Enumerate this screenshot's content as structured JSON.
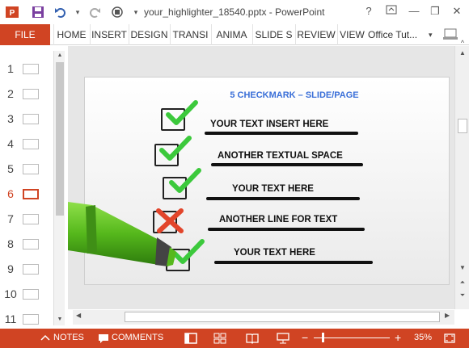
{
  "window": {
    "title": "your_highlighter_18540.pptx - PowerPoint",
    "help": "?",
    "minimize": "—",
    "restore": "❐",
    "close": "✕"
  },
  "ribbon": {
    "file": "FILE",
    "tabs": [
      "HOME",
      "INSERT",
      "DESIGN",
      "TRANSI",
      "ANIMA",
      "SLIDE S",
      "REVIEW",
      "VIEW"
    ],
    "account": "Office Tut..."
  },
  "thumbnails": {
    "numbers": [
      "1",
      "2",
      "3",
      "4",
      "5",
      "6",
      "7",
      "8",
      "9",
      "10",
      "11"
    ],
    "active": "6"
  },
  "slide": {
    "title": "5 CHECKMARK – SLIDE/PAGE",
    "items": [
      {
        "text": "YOUR TEXT INSERT HERE",
        "mark": "check"
      },
      {
        "text": "ANOTHER TEXTUAL SPACE",
        "mark": "check"
      },
      {
        "text": "YOUR TEXT HERE",
        "mark": "check"
      },
      {
        "text": "ANOTHER LINE FOR TEXT",
        "mark": "cross"
      },
      {
        "text": "YOUR TEXT HERE",
        "mark": "check"
      }
    ],
    "colors": {
      "check": "#3cc93c",
      "cross": "#e2452b",
      "highlighter": "#5cc21f",
      "title": "#3a6fd8"
    }
  },
  "statusbar": {
    "notes": "NOTES",
    "comments": "COMMENTS",
    "zoom_minus": "−",
    "zoom_plus": "+",
    "zoom": "35%"
  },
  "icons": {
    "app": "powerpoint-icon",
    "save": "save-icon",
    "undo": "undo-icon",
    "redo": "redo-icon",
    "present": "present-icon"
  }
}
